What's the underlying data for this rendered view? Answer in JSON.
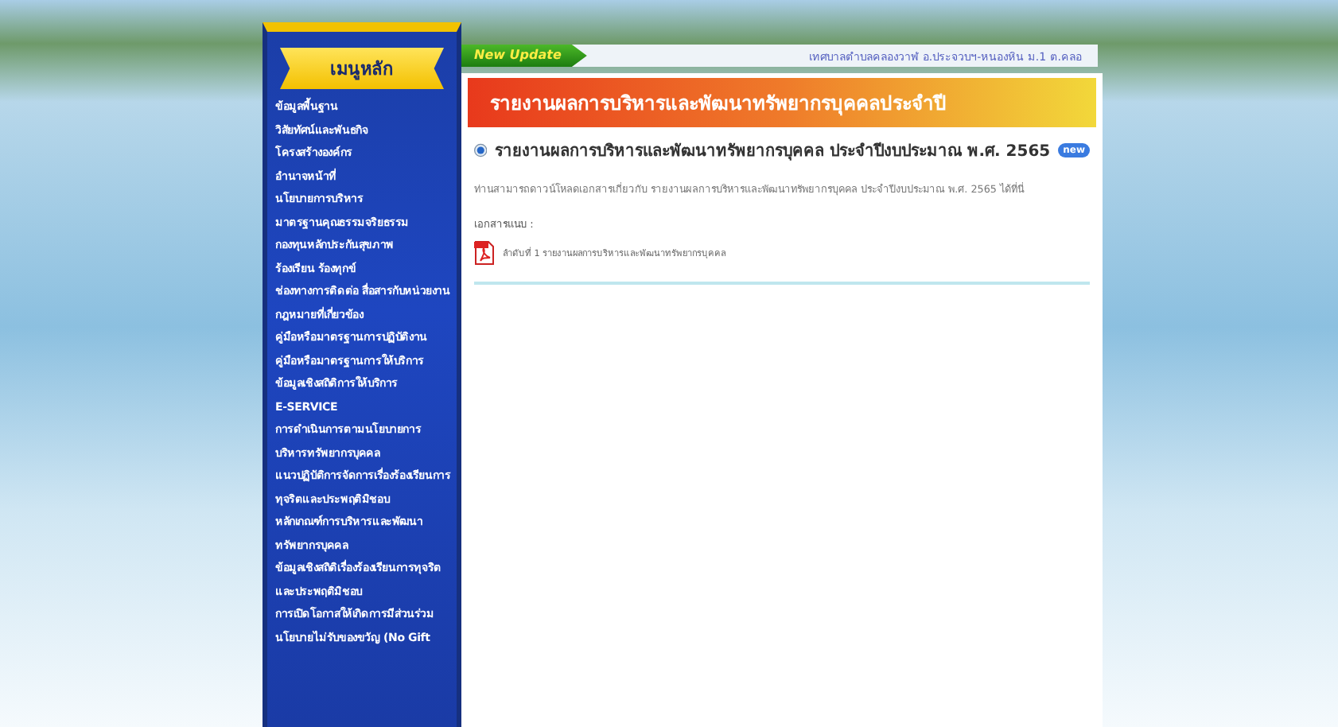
{
  "sidebar": {
    "title": "เมนูหลัก",
    "items": [
      {
        "label": "ข้อมูลพื้นฐาน"
      },
      {
        "label": "วิสัยทัศน์และพันธกิจ"
      },
      {
        "label": "โครงสร้างองค์กร"
      },
      {
        "label": "อำนาจหน้าที่"
      },
      {
        "label": "นโยบายการบริหาร"
      },
      {
        "label": "มาตรฐานคุณธรรมจริยธรรม"
      },
      {
        "label": "กองทุนหลักประกันสุขภาพ"
      },
      {
        "label": "ร้องเรียน ร้องทุกข์"
      },
      {
        "label": "ช่องทางการติดต่อ สื่อสารกับหน่วยงาน"
      },
      {
        "label": "กฎหมายที่เกี่ยวข้อง"
      },
      {
        "label": "คู่มือหรือมาตรฐานการปฏิบัติงาน"
      },
      {
        "label": "คู่มือหรือมาตรฐานการให้บริการ"
      },
      {
        "label": "ข้อมูลเชิงสถิติการให้บริการ"
      },
      {
        "label": "E-SERVICE"
      },
      {
        "label": "การดำเนินการตามนโยบายการบริหารทรัพยากรบุคคล"
      },
      {
        "label": "แนวปฏิบัติการจัดการเรื่องร้องเรียนการทุจริตและประพฤติมิชอบ"
      },
      {
        "label": "หลักเกณฑ์การบริหารและพัฒนาทรัพยากรบุคคล"
      },
      {
        "label": "ข้อมูลเชิงสถิติเรื่องร้องเรียนการทุจริตและประพฤติมิชอบ"
      },
      {
        "label": "การเปิดโอกาสให้เกิดการมีส่วนร่วม"
      },
      {
        "label": "นโยบายไม่รับของขวัญ (No Gift"
      }
    ]
  },
  "news_bar": {
    "badge": "New Update",
    "text": "เทศบาลตำบลคลองวาฬ อ.ประจวบฯ-หนองหิน ม.1 ต.คลอ"
  },
  "page_title": "รายงานผลการบริหารและพัฒนาทรัพยากรบุคคลประจำปี",
  "article": {
    "heading": "รายงานผลการบริหารและพัฒนาทรัพยากรบุคคล ประจำปีงบประมาณ พ.ศ. 2565",
    "badge": "new",
    "description": "ท่านสามารถดาวน์โหลดเอกสารเกี่ยวกับ รายงานผลการบริหารและพัฒนาทรัพยากรบุคคล ประจำปีงบประมาณ พ.ศ. 2565 ได้ที่นี่",
    "attachments_label": "เอกสารแนบ :",
    "attachments": [
      {
        "label": "ลำดับที่ 1 รายงานผลการบริหารและพัฒนาทรัพยากรบุคคล"
      }
    ]
  }
}
